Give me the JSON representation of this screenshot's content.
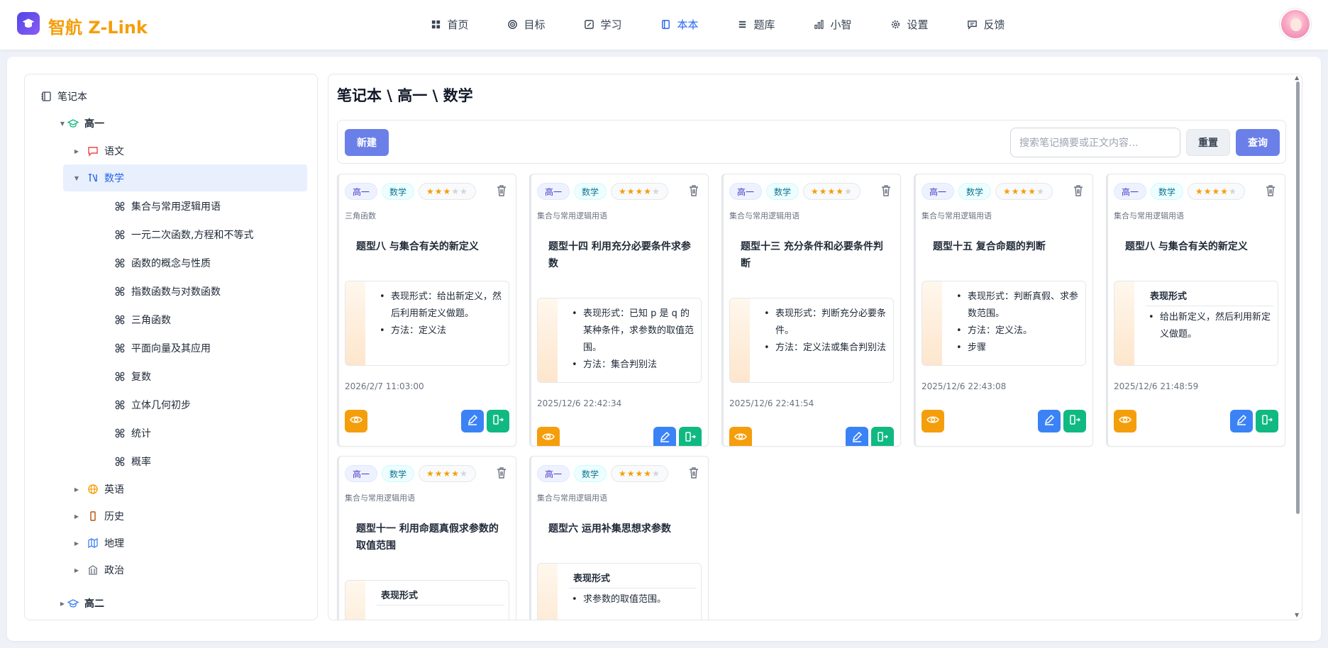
{
  "app": {
    "name": "智航 Z-Link"
  },
  "nav": [
    {
      "label": "首页",
      "icon": "grid-icon"
    },
    {
      "label": "目标",
      "icon": "target-icon"
    },
    {
      "label": "学习",
      "icon": "study-icon"
    },
    {
      "label": "本本",
      "icon": "notebook-icon",
      "active": true
    },
    {
      "label": "题库",
      "icon": "list-icon"
    },
    {
      "label": "小智",
      "icon": "chart-icon"
    },
    {
      "label": "设置",
      "icon": "gear-icon"
    },
    {
      "label": "反馈",
      "icon": "chat-icon"
    }
  ],
  "tree": {
    "root": "笔记本",
    "grade1": "高一",
    "subjects": [
      "语文",
      "数学",
      "英语",
      "历史",
      "地理",
      "政治"
    ],
    "math_topics": [
      "集合与常用逻辑用语",
      "一元二次函数,方程和不等式",
      "函数的概念与性质",
      "指数函数与对数函数",
      "三角函数",
      "平面向量及其应用",
      "复数",
      "立体几何初步",
      "统计",
      "概率"
    ],
    "grade2": "高二"
  },
  "breadcrumb": "笔记本 \\ 高一 \\ 数学",
  "toolbar": {
    "new_label": "新建",
    "search_placeholder": "搜索笔记摘要或正文内容...",
    "reset_label": "重置",
    "query_label": "查询"
  },
  "cards": [
    {
      "grade": "高一",
      "subject": "数学",
      "stars": 3,
      "category": "三角函数",
      "title": "题型八 与集合有关的新定义",
      "preview": [
        "表现形式：给出新定义，然后利用新定义做题。",
        "方法：定义法"
      ],
      "date": "2026/2/7 11:03:00"
    },
    {
      "grade": "高一",
      "subject": "数学",
      "stars": 4,
      "category": "集合与常用逻辑用语",
      "title": "题型十四 利用充分必要条件求参数",
      "preview": [
        "表现形式：已知 p 是 q 的某种条件，求参数的取值范围。",
        "方法：集合判别法"
      ],
      "date": "2025/12/6 22:42:34"
    },
    {
      "grade": "高一",
      "subject": "数学",
      "stars": 4,
      "category": "集合与常用逻辑用语",
      "title": "题型十三 充分条件和必要条件判断",
      "preview": [
        "表现形式：判断充分必要条件。",
        "方法：定义法或集合判别法"
      ],
      "date": "2025/12/6 22:41:54"
    },
    {
      "grade": "高一",
      "subject": "数学",
      "stars": 4,
      "category": "集合与常用逻辑用语",
      "title": "题型十五 复合命题的判断",
      "preview": [
        "表现形式：判断真假、求参数范围。",
        "方法：定义法。",
        "步骤"
      ],
      "date": "2025/12/6 22:43:08"
    },
    {
      "grade": "高一",
      "subject": "数学",
      "stars": 4,
      "category": "集合与常用逻辑用语",
      "title": "题型八 与集合有关的新定义",
      "preview_head": "表现形式",
      "preview": [
        "给出新定义，然后利用新定义做题。"
      ],
      "date": "2025/12/6 21:48:59"
    },
    {
      "grade": "高一",
      "subject": "数学",
      "stars": 4,
      "category": "集合与常用逻辑用语",
      "title": "题型十一 利用命题真假求参数的取值范围",
      "preview_head": "表现形式",
      "preview": [],
      "date": ""
    },
    {
      "grade": "高一",
      "subject": "数学",
      "stars": 4,
      "category": "集合与常用逻辑用语",
      "title": "题型六 运用补集思想求参数",
      "preview_head": "表现形式",
      "preview": [
        "求参数的取值范围。"
      ],
      "date": ""
    }
  ]
}
